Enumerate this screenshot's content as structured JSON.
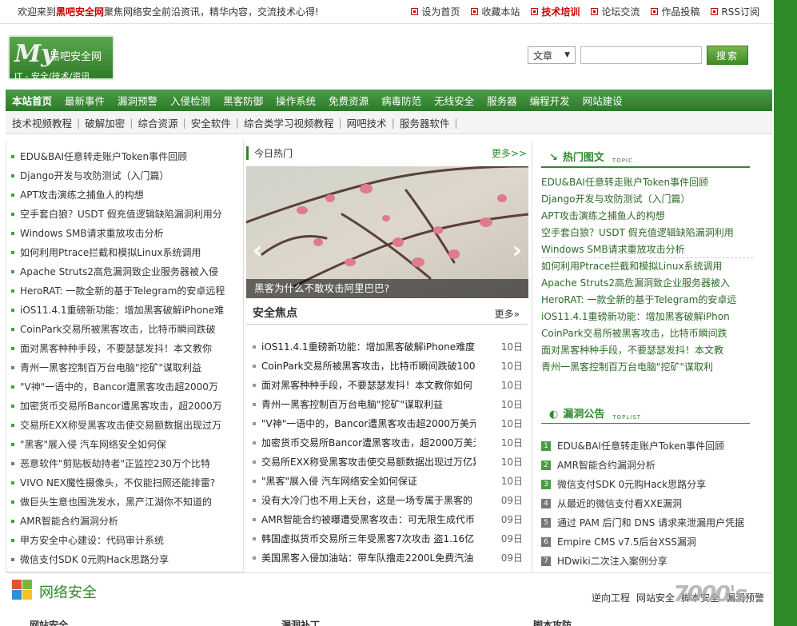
{
  "topbar": {
    "welcome_pre": "欢迎来到",
    "site_name": "黑吧安全网",
    "welcome_post": "聚焦网络安全前沿资讯，精华内容，交流技术心得!",
    "links": [
      "设为首页",
      "收藏本站",
      "技术培训",
      "论坛交流",
      "作品投稿",
      "RSS订阅"
    ]
  },
  "logo": {
    "my": "My",
    "name": "黑吧安全网",
    "tagline": "IT - 安全/技术/资讯"
  },
  "search": {
    "select_value": "文章",
    "button": "搜索"
  },
  "mainnav": [
    "本站首页",
    "最新事件",
    "漏洞预警",
    "入侵检测",
    "黑客防御",
    "操作系统",
    "免费资源",
    "病毒防范",
    "无线安全",
    "服务器",
    "编程开发",
    "网站建设"
  ],
  "subnav": [
    "技术视频教程",
    "破解加密",
    "综合资源",
    "安全软件",
    "综合类学习视频教程",
    "网吧技术",
    "服务器软件"
  ],
  "left_list": [
    "EDU&BAI任意转走账户Token事件回顾",
    "Django开发与攻防测试（入门篇）",
    "APT攻击演练之捕鱼人的构想",
    "空手套白狼？USDT 假充值逻辑缺陷漏洞利用分",
    "Windows SMB请求重放攻击分析",
    "如何利用Ptrace拦截和模拟Linux系统调用",
    "Apache Struts2高危漏洞致企业服务器被入侵",
    "HeroRAT: 一款全新的基于Telegram的安卓远程",
    "iOS11.4.1重磅新功能：增加黑客破解iPhone难",
    "CoinPark交易所被黑客攻击，比特币瞬间跌破",
    "面对黑客种种手段，不要瑟瑟发抖！本文教你",
    "青州一黑客控制百万台电脑\"挖矿\"谋取利益",
    "\"V神\"一语中的，Bancor遭黑客攻击超2000万",
    "加密货币交易所Bancor遭黑客攻击，超2000万",
    "交易所EXX称受黑客攻击使交易额数据出现过万",
    "\"黑客\"展入侵 汽车网络安全如何保",
    "恶意软件\"剪贴板劫持者\"正监控230万个比特",
    "VIVO NEX魔性摄像头，不仅能扫照还能排雷?",
    "做巨头生意也围洗发水，黑产江湖你不知道的",
    "AMR智能合约漏洞分析",
    "甲方安全中心建设：代码审计系统",
    "微信支付SDK 0元购Hack思路分享"
  ],
  "hot": {
    "title": "今日热门",
    "more": "更多>>",
    "slide_caption": "黑客为什么不敢攻击阿里巴巴?",
    "prev": "‹",
    "next": "›"
  },
  "focus": {
    "title": "安全焦点",
    "more": "更多»",
    "items": [
      {
        "title": "iOS11.4.1重磅新功能：增加黑客破解iPhone难度",
        "date": "10日"
      },
      {
        "title": "CoinPark交易所被黑客攻击，比特币瞬间跌破1000",
        "date": "10日"
      },
      {
        "title": "面对黑客种种手段，不要瑟瑟发抖！本文教你如何",
        "date": "10日"
      },
      {
        "title": "青州一黑客控制百万台电脑\"挖矿\"谋取利益",
        "date": "10日"
      },
      {
        "title": "\"V神\"一语中的，Bancor遭黑客攻击超2000万美元",
        "date": "10日"
      },
      {
        "title": "加密货币交易所Bancor遭黑客攻击，超2000万美元",
        "date": "10日"
      },
      {
        "title": "交易所EXX称受黑客攻击使交易额数据出现过万亿异",
        "date": "10日"
      },
      {
        "title": "\"黑客\"展入侵 汽车网络安全如何保证",
        "date": "10日"
      },
      {
        "title": "没有大冷门也不用上天台，这是一场专属于黑客的",
        "date": "09日"
      },
      {
        "title": "AMR智能合约被曝遭受黑客攻击：可无限生成代币",
        "date": "09日"
      },
      {
        "title": "韩国虚拟货币交易所三年受黑客7次攻击 盗1.16亿",
        "date": "09日"
      },
      {
        "title": "美国黑客入侵加油站：带车队撸走2200L免费汽油",
        "date": "09日"
      }
    ]
  },
  "topic": {
    "icon": "↘",
    "title": "热门图文",
    "en": "TOPIC",
    "items": [
      "EDU&BAI任意转走账户Token事件回顾",
      "Django开发与攻防测试（入门篇）",
      "APT攻击演练之捕鱼人的构想",
      "空手套白狼？USDT 假充值逻辑缺陷漏洞利用",
      "Windows SMB请求重放攻击分析",
      "如何利用Ptrace拦截和模拟Linux系统调用",
      "Apache Struts2高危漏洞致企业服务器被入",
      "HeroRAT: 一款全新的基于Telegram的安卓远",
      "iOS11.4.1重磅新功能：增加黑客破解iPhon",
      "CoinPark交易所被黑客攻击，比特币瞬间跌",
      "面对黑客种种手段，不要瑟瑟发抖！本文教",
      "青州一黑客控制百万台电脑\"挖矿\"谋取利"
    ]
  },
  "notice": {
    "icon": "◐",
    "title": "漏洞公告",
    "en": "TOPLIST",
    "items": [
      {
        "num": "1",
        "title": "EDU&BAI任意转走账户Token事件回顾"
      },
      {
        "num": "2",
        "title": "AMR智能合约漏洞分析"
      },
      {
        "num": "3",
        "title": "微信支付SDK 0元购Hack思路分享"
      },
      {
        "num": "4",
        "title": "从最近的微信支付看XXE漏洞"
      },
      {
        "num": "5",
        "title": "通过 PAM 后门和 DNS 请求来泄漏用户凭据"
      },
      {
        "num": "6",
        "title": "Empire CMS v7.5后台XSS漏洞"
      },
      {
        "num": "7",
        "title": "HDwiki二次注入案例分享"
      }
    ]
  },
  "bottom": {
    "title": "网络安全",
    "links": [
      "逆向工程",
      "网站安全",
      "脚本安全",
      "漏洞预警"
    ],
    "subtitles": [
      "网站安全",
      "漏洞补丁",
      "脚本攻防"
    ]
  },
  "watermark": "7000's",
  "colors": {
    "brand_green": "#2f8a2a",
    "hot_red": "#cc0000"
  }
}
